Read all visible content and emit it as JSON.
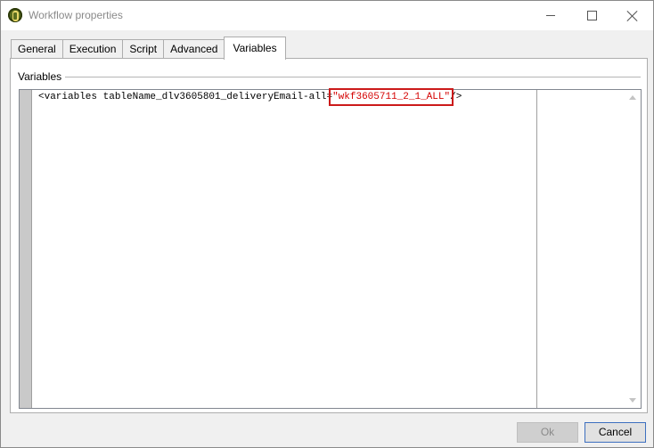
{
  "window": {
    "title": "Workflow properties"
  },
  "tabs": [
    {
      "label": "General"
    },
    {
      "label": "Execution"
    },
    {
      "label": "Script"
    },
    {
      "label": "Advanced"
    },
    {
      "label": "Variables"
    }
  ],
  "active_tab": "Variables",
  "variables_panel": {
    "group_label": "Variables",
    "code_prefix": "<variables tableName_dlv3605801_deliveryEmail-all=",
    "code_value": "\"wkf3605711_2_1_ALL\"",
    "code_suffix": "/>"
  },
  "buttons": {
    "ok": "Ok",
    "cancel": "Cancel"
  }
}
